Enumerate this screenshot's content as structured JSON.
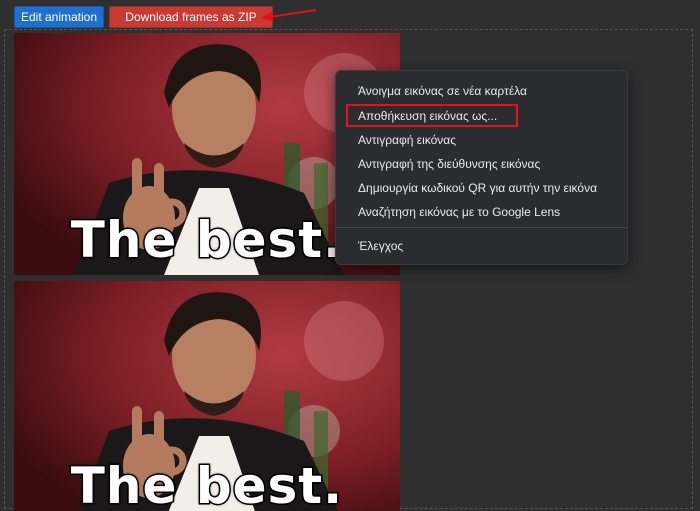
{
  "toolbar": {
    "edit_label": "Edit animation",
    "zip_label": "Download frames as ZIP"
  },
  "frames": [
    {
      "caption": "The best."
    },
    {
      "caption": "The best."
    }
  ],
  "context_menu": {
    "items": [
      "Άνοιγμα εικόνας σε νέα καρτέλα",
      "Αποθήκευση εικόνας ως...",
      "Αντιγραφή εικόνας",
      "Αντιγραφή της διεύθυνσης εικόνας",
      "Δημιουργία κωδικού QR για αυτήν την εικόνα",
      "Αναζήτηση εικόνας με το Google Lens"
    ],
    "inspect": "Έλεγχος",
    "highlighted_index": 1
  },
  "colors": {
    "edit_button": "#1f6fcf",
    "zip_button": "#c83a34",
    "annotation_red": "#e0121a",
    "menu_bg": "#2b2c2f"
  }
}
